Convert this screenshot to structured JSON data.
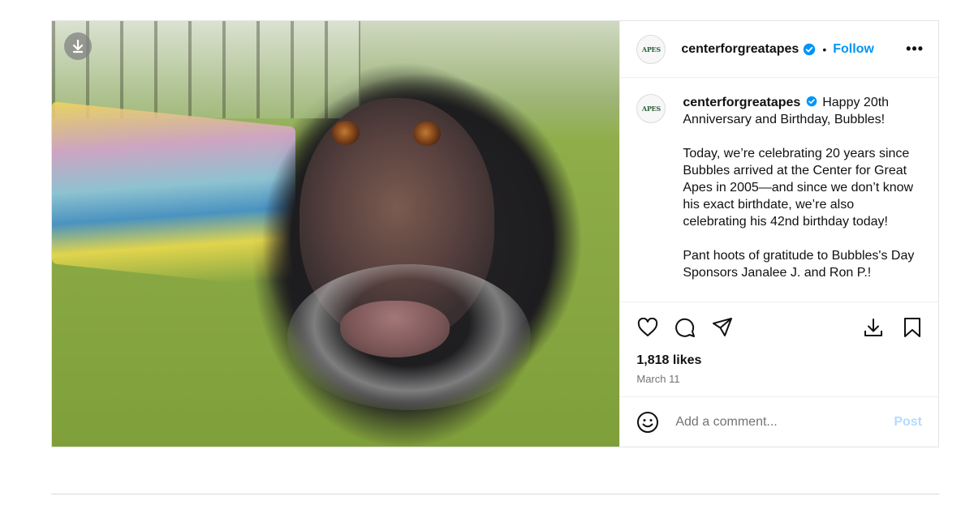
{
  "post": {
    "media_alt": "chimpanzee portrait",
    "download_icon": "download-arrow-icon"
  },
  "header": {
    "username": "centerforgreatapes",
    "avatar_text": "APES",
    "separator": "•",
    "follow_label": "Follow",
    "more_label": "•••",
    "verified_color": "#0095f6"
  },
  "caption": {
    "username": "centerforgreatapes",
    "paragraphs": [
      "Happy 20th Anniversary and Birthday, Bubbles!",
      "Today, we’re celebrating 20 years since Bubbles arrived at the Center for Great Apes in 2005—and since we don’t know his exact birthdate, we’re also celebrating his 42nd birthday today!",
      "Pant hoots of gratitude to Bubbles's Day Sponsors Janalee J. and Ron P.!"
    ]
  },
  "actions": {
    "icons": [
      "heart-icon",
      "comment-icon",
      "share-icon",
      "download-icon",
      "bookmark-icon"
    ]
  },
  "stats": {
    "likes": "1,818 likes",
    "date": "March 11"
  },
  "comment": {
    "placeholder": "Add a comment...",
    "post_label": "Post"
  }
}
